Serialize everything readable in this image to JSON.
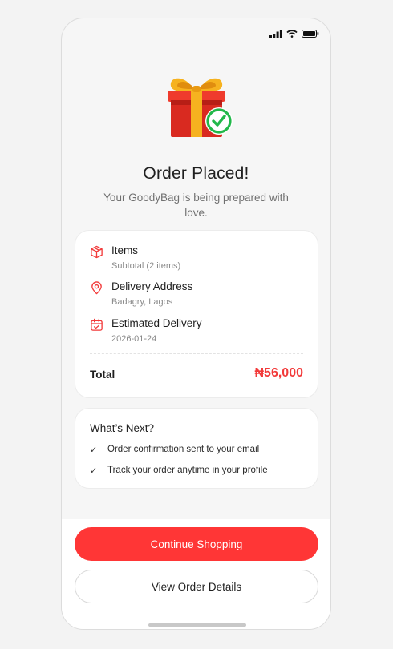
{
  "header": {
    "title": "Order Placed!",
    "subtitle": "Your GoodyBag is being prepared with love."
  },
  "summary": {
    "items": [
      {
        "icon": "box-icon",
        "label": "Items",
        "value": "Subtotal (2 items)"
      },
      {
        "icon": "location-pin-icon",
        "label": "Delivery Address",
        "value": "Badagry, Lagos"
      },
      {
        "icon": "calendar-icon",
        "label": "Estimated Delivery",
        "value": "2026-01-24"
      }
    ],
    "total_label": "Total",
    "total_value": "₦56,000"
  },
  "next": {
    "title": "What’s Next?",
    "steps": [
      "Order confirmation sent to your email",
      "Track your order anytime in your profile"
    ]
  },
  "buttons": {
    "primary": "Continue Shopping",
    "secondary": "View Order Details"
  },
  "colors": {
    "accent": "#ff3636",
    "success": "#22b84a"
  }
}
